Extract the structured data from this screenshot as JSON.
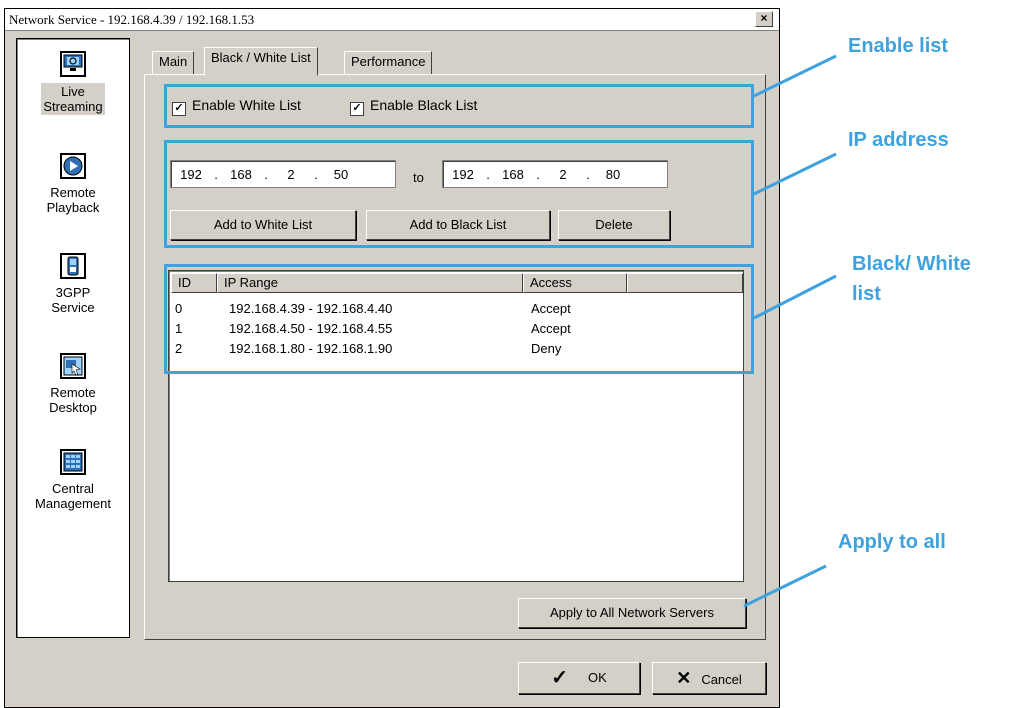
{
  "window": {
    "title": "Network Service - 192.168.4.39 / 192.168.1.53",
    "close_label": "×"
  },
  "sidebar": {
    "items": [
      {
        "label": "Live\nStreaming",
        "icon": "monitor-icon"
      },
      {
        "label": "Remote\nPlayback",
        "icon": "play-icon"
      },
      {
        "label": "3GPP\nService",
        "icon": "phone-icon"
      },
      {
        "label": "Remote\nDesktop",
        "icon": "remote-desktop-icon"
      },
      {
        "label": "Central\nManagement",
        "icon": "grid-icon"
      }
    ]
  },
  "tabs": [
    {
      "label": "Main"
    },
    {
      "label": "Black / White List"
    },
    {
      "label": "Performance"
    }
  ],
  "enable": {
    "white_label": "Enable White List",
    "black_label": "Enable Black List",
    "white_checked": true,
    "black_checked": true,
    "check_mark": "✓"
  },
  "ip": {
    "from": [
      "192",
      "168",
      "2",
      "50"
    ],
    "to": [
      "192",
      "168",
      "2",
      "80"
    ],
    "to_label": "to",
    "dot": "."
  },
  "buttons": {
    "add_white": "Add to White List",
    "add_black": "Add to Black List",
    "delete": "Delete",
    "apply_all": "Apply to All Network Servers",
    "ok": "OK",
    "cancel": "Cancel"
  },
  "list": {
    "columns": [
      "ID",
      "IP Range",
      "Access"
    ],
    "rows": [
      {
        "id": "0",
        "range": "192.168.4.39 - 192.168.4.40",
        "access": "Accept"
      },
      {
        "id": "1",
        "range": "192.168.4.50 - 192.168.4.55",
        "access": "Accept"
      },
      {
        "id": "2",
        "range": "192.168.1.80 - 192.168.1.90",
        "access": "Deny"
      }
    ]
  },
  "callouts": {
    "enable_list": "Enable list",
    "ip_address": "IP address",
    "bw_list_1": "Black/ White",
    "bw_list_2": "list",
    "apply_all": "Apply to all"
  },
  "colors": {
    "callout": "#3ea2de",
    "dialog_bg": "#d4d0c8"
  }
}
